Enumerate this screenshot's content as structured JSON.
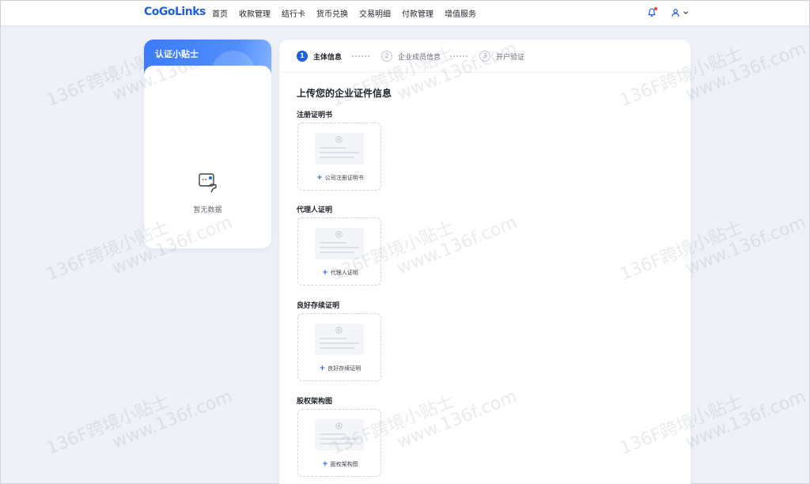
{
  "header": {
    "logo": "CoGoLinks",
    "nav": [
      "首页",
      "收款管理",
      "结行卡",
      "货币兑换",
      "交易明细",
      "付款管理",
      "增值服务"
    ]
  },
  "tips": {
    "title": "认证小贴士",
    "empty_text": "暂无数据"
  },
  "steps": [
    {
      "num": "1",
      "label": "主体信息",
      "state": "active"
    },
    {
      "num": "2",
      "label": "企业成员信息",
      "state": "idle"
    },
    {
      "num": "3",
      "label": "开户验证",
      "state": "idle"
    }
  ],
  "main": {
    "section_title": "上传您的企业证件信息",
    "fields": [
      {
        "label": "注册证明书",
        "upload_label": "公司注册证明书"
      },
      {
        "label": "代理人证明",
        "upload_label": "代理人证明"
      },
      {
        "label": "良好存续证明",
        "upload_label": "良好存续证明"
      },
      {
        "label": "股权架构图",
        "upload_label": "股权架构图"
      }
    ]
  },
  "watermark": {
    "line1": "136F跨境小贴士",
    "line2": "www.136f.com"
  },
  "colors": {
    "accent": "#1f5fe0",
    "notification_dot": "#ff3b30"
  },
  "icons": {
    "notification": "bell-icon",
    "user": "user-icon",
    "dropdown": "chevron-down-icon",
    "empty": "empty-data-icon",
    "upload": "plus-icon"
  }
}
